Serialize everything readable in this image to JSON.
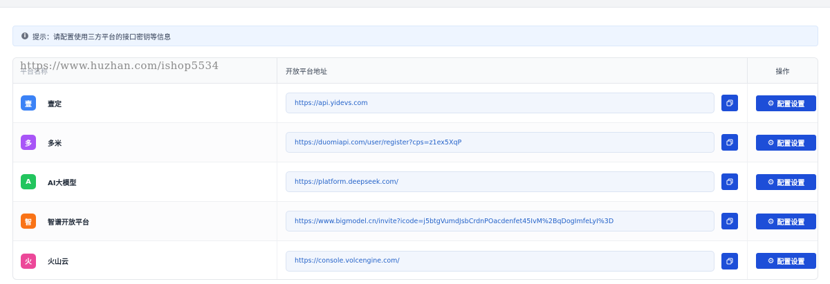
{
  "tip": {
    "text": "提示：请配置使用三方平台的接口密钥等信息",
    "icon": "info-icon"
  },
  "watermark": "https://www.huzhan.com/ishop5534",
  "table": {
    "headers": {
      "name": "平台名称",
      "url": "开放平台地址",
      "op": "操作"
    },
    "rows": [
      {
        "initial": "壹",
        "name": "壹定",
        "url": "https://api.yidevs.com",
        "color": "#3b82f6"
      },
      {
        "initial": "多",
        "name": "多米",
        "url": "https://duomiapi.com/user/register?cps=z1ex5XqP",
        "color": "#a855f7"
      },
      {
        "initial": "A",
        "name": "AI大模型",
        "url": "https://platform.deepseek.com/",
        "color": "#22c55e"
      },
      {
        "initial": "智",
        "name": "智谱开放平台",
        "url": "https://www.bigmodel.cn/invite?icode=j5btgVumdJsbCrdnPOacdenfet45IvM%2BqDogImfeLyI%3D",
        "color": "#f97316"
      },
      {
        "initial": "火",
        "name": "火山云",
        "url": "https://console.volcengine.com/",
        "color": "#ec4899"
      }
    ],
    "config_label": "配置设置"
  },
  "colors": {
    "primary": "#1d4ed8",
    "link": "#2563c9"
  }
}
